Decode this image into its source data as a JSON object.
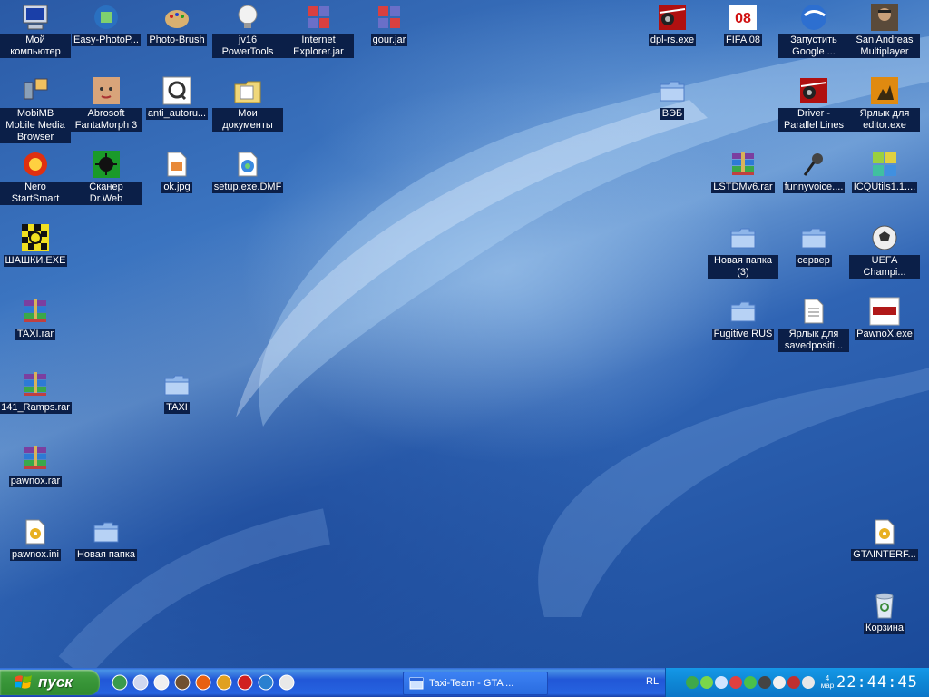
{
  "desktop": {
    "icons": [
      {
        "label": "Мой компьютер",
        "icon": "my-computer-icon"
      },
      {
        "label": "Easy-PhotoP...",
        "icon": "photo-app-icon"
      },
      {
        "label": "Photo-Brush",
        "icon": "palette-icon"
      },
      {
        "label": "jv16 PowerTools",
        "icon": "bulb-icon"
      },
      {
        "label": "Internet Explorer.jar",
        "icon": "jar-icon"
      },
      {
        "label": "gour.jar",
        "icon": "jar-icon"
      },
      {
        "label": "dpl-rs.exe",
        "icon": "car-game-icon"
      },
      {
        "label": "FIFA 08",
        "icon": "fifa-icon"
      },
      {
        "label": "Запустить Google ...",
        "icon": "google-earth-icon"
      },
      {
        "label": "San Andreas Multiplayer",
        "icon": "samp-icon"
      },
      {
        "label": "MobiMB Mobile Media Browser",
        "icon": "phone-icon"
      },
      {
        "label": "Abrosoft FantaMorph 3",
        "icon": "face-icon"
      },
      {
        "label": "anti_autoru...",
        "icon": "q-icon"
      },
      {
        "label": "Мои документы",
        "icon": "my-documents-icon"
      },
      {
        "label": "ВЭБ",
        "icon": "folder-icon"
      },
      {
        "label": "Driver - Parallel Lines",
        "icon": "car-game-icon"
      },
      {
        "label": "Ярлык для editor.exe",
        "icon": "editor-icon"
      },
      {
        "label": "Nero StartSmart",
        "icon": "nero-icon"
      },
      {
        "label": "Сканер Dr.Web",
        "icon": "drweb-icon"
      },
      {
        "label": "ok.jpg",
        "icon": "image-file-icon"
      },
      {
        "label": "setup.exe.DMF",
        "icon": "setup-file-icon"
      },
      {
        "label": "LSTDMv6.rar",
        "icon": "rar-icon"
      },
      {
        "label": "funnyvoice....",
        "icon": "microphone-icon"
      },
      {
        "label": "ICQUtils1.1....",
        "icon": "puzzle-icon"
      },
      {
        "label": "ШАШКИ.EXE",
        "icon": "checkers-icon"
      },
      {
        "label": "Новая папка (3)",
        "icon": "folder-icon"
      },
      {
        "label": "сервер",
        "icon": "folder-icon"
      },
      {
        "label": "UEFA Champi...",
        "icon": "soccer-ball-icon"
      },
      {
        "label": "TAXI.rar",
        "icon": "rar-icon"
      },
      {
        "label": "Fugitive RUS",
        "icon": "folder-icon"
      },
      {
        "label": "Ярлык для savedpositi...",
        "icon": "text-file-icon"
      },
      {
        "label": "PawnoX.exe",
        "icon": "pawnox-icon"
      },
      {
        "label": "141_Ramps.rar",
        "icon": "rar-icon"
      },
      {
        "label": "TAXI",
        "icon": "folder-icon"
      },
      {
        "label": "pawnox.rar",
        "icon": "rar-icon"
      },
      {
        "label": "pawnox.ini",
        "icon": "ini-file-icon"
      },
      {
        "label": "Новая папка",
        "icon": "folder-icon"
      },
      {
        "label": "GTAINTERF...",
        "icon": "ini-file-icon"
      },
      {
        "label": "Корзина",
        "icon": "recycle-bin-icon"
      }
    ]
  },
  "taskbar": {
    "start_label": "пуск",
    "quick_launch": [
      "earth-icon",
      "media-icon",
      "bulb-icon",
      "game-icon",
      "at-icon",
      "aim-icon",
      "phone-icon",
      "ie-icon",
      "player-icon"
    ],
    "task_button_label": "Taxi-Team - GTA ...",
    "language": "RL",
    "clock": {
      "day": "4",
      "month": "мар",
      "time": "22:44:45"
    }
  }
}
